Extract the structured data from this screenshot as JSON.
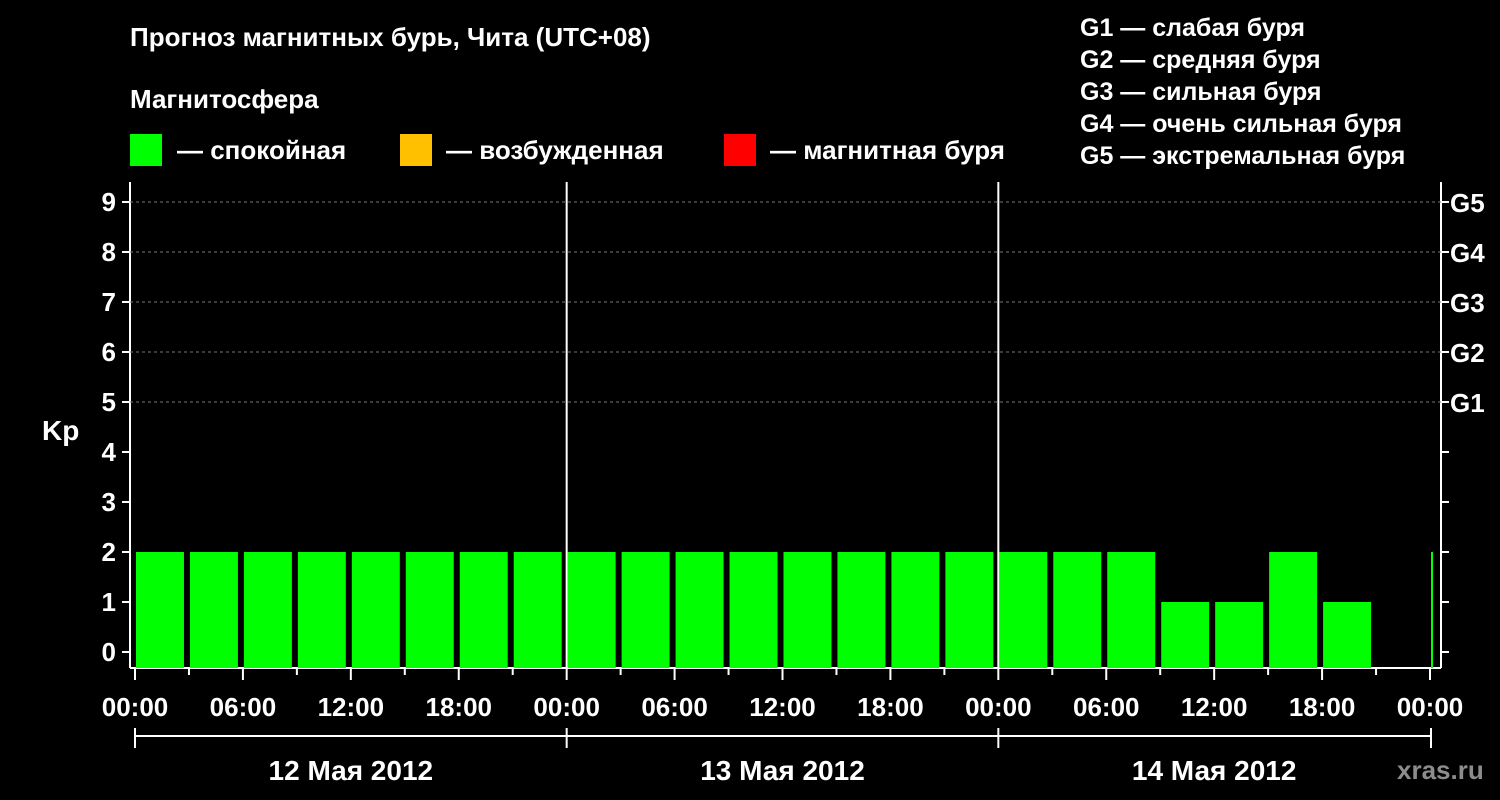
{
  "header": {
    "title": "Прогноз магнитных бурь, Чита (UTC+08)"
  },
  "legend": {
    "title": "Магнитосфера",
    "items": [
      {
        "label": "— спокойная",
        "color": "#00ff00"
      },
      {
        "label": "— возбужденная",
        "color": "#ffc000"
      },
      {
        "label": "— магнитная буря",
        "color": "#ff0000"
      }
    ]
  },
  "g_scale": [
    "G1 — слабая буря",
    "G2 — средняя буря",
    "G3 — сильная буря",
    "G4 — очень сильная буря",
    "G5 — экстремальная буря"
  ],
  "watermark": "xras.ru",
  "chart_data": {
    "type": "bar",
    "ylabel": "Kp",
    "ylim": [
      0,
      9
    ],
    "yticks": [
      "0",
      "1",
      "2",
      "3",
      "4",
      "5",
      "6",
      "7",
      "8",
      "9"
    ],
    "right_axis": {
      "labels": [
        "G1",
        "G2",
        "G3",
        "G4",
        "G5"
      ],
      "levels": [
        5,
        6,
        7,
        8,
        9
      ]
    },
    "grid": "horizontal dashed at 5-9",
    "bar_color": "#00ff00",
    "interval_hours": 3,
    "values": [
      2,
      2,
      2,
      2,
      2,
      2,
      2,
      2,
      2,
      2,
      2,
      2,
      2,
      2,
      2,
      2,
      2,
      2,
      2,
      1,
      1,
      2,
      1,
      null,
      2
    ],
    "x_tick_labels": [
      "00:00",
      "06:00",
      "12:00",
      "18:00",
      "00:00",
      "06:00",
      "12:00",
      "18:00",
      "00:00",
      "06:00",
      "12:00",
      "18:00",
      "00:00"
    ],
    "days": [
      "12 Мая 2012",
      "13 Мая 2012",
      "14 Мая 2012"
    ]
  }
}
